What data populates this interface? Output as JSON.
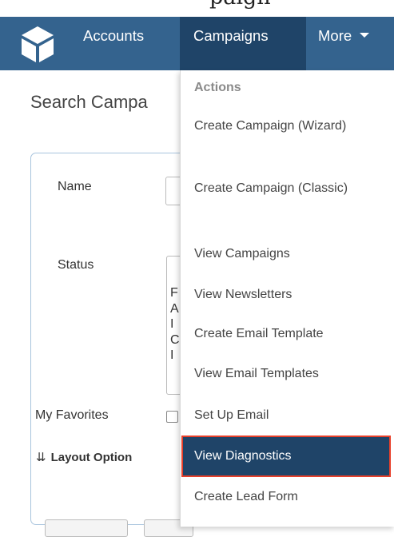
{
  "top_fragment": "paign",
  "nav": {
    "items": [
      "Accounts",
      "Campaigns",
      "More"
    ]
  },
  "page": {
    "title": "Search Campa"
  },
  "search_form": {
    "name_label": "Name",
    "status_label": "Status",
    "status_option_fragments": [
      "F",
      "A",
      "I",
      "C",
      "I"
    ],
    "favorites_label": "My Favorites",
    "layout_options_label": "Layout Option"
  },
  "dropdown": {
    "header": "Actions",
    "items": [
      "Create Campaign (Wizard)",
      "Create Campaign (Classic)",
      "View Campaigns",
      "View Newsletters",
      "Create Email Template",
      "View Email Templates",
      "Set Up Email",
      "View Diagnostics",
      "Create Lead Form"
    ],
    "highlighted_item": "View Diagnostics"
  },
  "colors": {
    "navbar": "#34638e",
    "nav_active": "#1f4468",
    "highlight_border": "#e8402a"
  }
}
